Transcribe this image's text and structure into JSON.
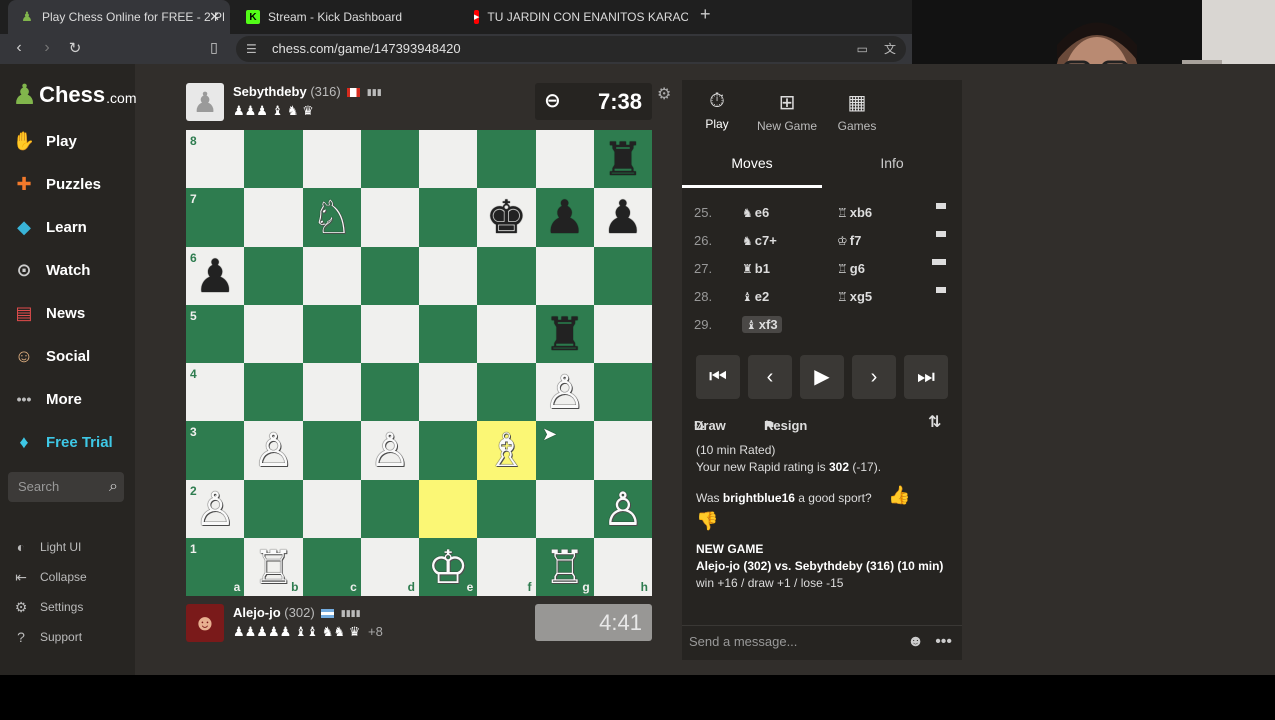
{
  "browser": {
    "tabs": [
      {
        "title": "Play Chess Online for FREE - 2 Pl",
        "icon": "chess-pawn-icon",
        "active": true
      },
      {
        "title": "Stream - Kick Dashboard",
        "icon": "kick-icon",
        "active": false
      },
      {
        "title": "TU JARDIN CON ENANITOS KARAOK",
        "icon": "youtube-icon",
        "active": false
      }
    ],
    "url": "chess.com/game/147393948420"
  },
  "sidebar": {
    "logo": "Chess",
    "logo_suffix": ".com",
    "items": [
      {
        "label": "Play",
        "icon": "play-hand-icon"
      },
      {
        "label": "Puzzles",
        "icon": "puzzle-icon"
      },
      {
        "label": "Learn",
        "icon": "learn-cube-icon"
      },
      {
        "label": "Watch",
        "icon": "binoculars-icon"
      },
      {
        "label": "News",
        "icon": "news-icon"
      },
      {
        "label": "Social",
        "icon": "social-icon"
      },
      {
        "label": "More",
        "icon": "more-dots-icon"
      },
      {
        "label": "Free Trial",
        "icon": "diamond-icon"
      }
    ],
    "search_placeholder": "Search",
    "bottom_items": [
      {
        "label": "Light UI",
        "icon": "light-ui-icon"
      },
      {
        "label": "Collapse",
        "icon": "collapse-icon"
      },
      {
        "label": "Settings",
        "icon": "gear-icon"
      },
      {
        "label": "Support",
        "icon": "question-icon"
      }
    ]
  },
  "top_player": {
    "name": "Sebythdeby",
    "rating": "(316)",
    "flag": "canada",
    "captured": "♟♟♟ ♝ ♞ ♛",
    "clock": "7:38"
  },
  "bottom_player": {
    "name": "Alejo-jo",
    "rating": "(302)",
    "flag": "argentina",
    "captured": "♟♟♟♟♟ ♝♝ ♞♞ ♛",
    "advantage": "+8",
    "clock": "4:41"
  },
  "board": {
    "files": [
      "a",
      "b",
      "c",
      "d",
      "e",
      "f",
      "g",
      "h"
    ],
    "ranks": [
      "8",
      "7",
      "6",
      "5",
      "4",
      "3",
      "2",
      "1"
    ],
    "highlight": [
      "e2",
      "f3"
    ],
    "pieces": [
      {
        "sq": "h8",
        "p": "r",
        "c": "b"
      },
      {
        "sq": "c7",
        "p": "n",
        "c": "w"
      },
      {
        "sq": "f7",
        "p": "k",
        "c": "b"
      },
      {
        "sq": "g7",
        "p": "p",
        "c": "b"
      },
      {
        "sq": "h7",
        "p": "p",
        "c": "b"
      },
      {
        "sq": "a6",
        "p": "p",
        "c": "b"
      },
      {
        "sq": "g5",
        "p": "r",
        "c": "b"
      },
      {
        "sq": "g4",
        "p": "p",
        "c": "w"
      },
      {
        "sq": "b3",
        "p": "p",
        "c": "w"
      },
      {
        "sq": "d3",
        "p": "p",
        "c": "w"
      },
      {
        "sq": "f3",
        "p": "b",
        "c": "w"
      },
      {
        "sq": "a2",
        "p": "p",
        "c": "w"
      },
      {
        "sq": "h2",
        "p": "p",
        "c": "w"
      },
      {
        "sq": "b1",
        "p": "r",
        "c": "w"
      },
      {
        "sq": "e1",
        "p": "k",
        "c": "w"
      },
      {
        "sq": "g1",
        "p": "r",
        "c": "w"
      }
    ]
  },
  "panel": {
    "tabs": [
      {
        "label": "Play",
        "icon": "stopwatch-icon"
      },
      {
        "label": "New Game",
        "icon": "plus-square-icon"
      },
      {
        "label": "Games",
        "icon": "games-grid-icon"
      }
    ],
    "subtabs": [
      "Moves",
      "Info"
    ],
    "moves": [
      {
        "n": "25.",
        "wi": "♞",
        "w": "e6",
        "bi": "♖",
        "b": "xb6"
      },
      {
        "n": "26.",
        "wi": "♞",
        "w": "c7+",
        "bi": "♔",
        "b": "f7"
      },
      {
        "n": "27.",
        "wi": "♜",
        "w": "b1",
        "bi": "♖",
        "b": "g6"
      },
      {
        "n": "28.",
        "wi": "♝",
        "w": "e2",
        "bi": "♖",
        "b": "xg5"
      },
      {
        "n": "29.",
        "wi": "♝",
        "w": "xf3",
        "bi": "",
        "b": ""
      }
    ],
    "draw_label": "Draw",
    "draw_icon": "½",
    "resign_label": "Resign",
    "game_info": {
      "line1": "(10 min Rated)",
      "rating_text": "Your new Rapid rating is",
      "rating_value": "302",
      "rating_delta": "(-17).",
      "sport_prefix": "Was",
      "sport_name": "brightblue16",
      "sport_suffix": "a good sport?",
      "new_game_title": "NEW GAME",
      "new_game_players": "Alejo-jo (302) vs. Sebythdeby (316) (10 min)",
      "new_game_record": "win +16 / draw +1 / lose -15"
    },
    "message_placeholder": "Send a message..."
  }
}
